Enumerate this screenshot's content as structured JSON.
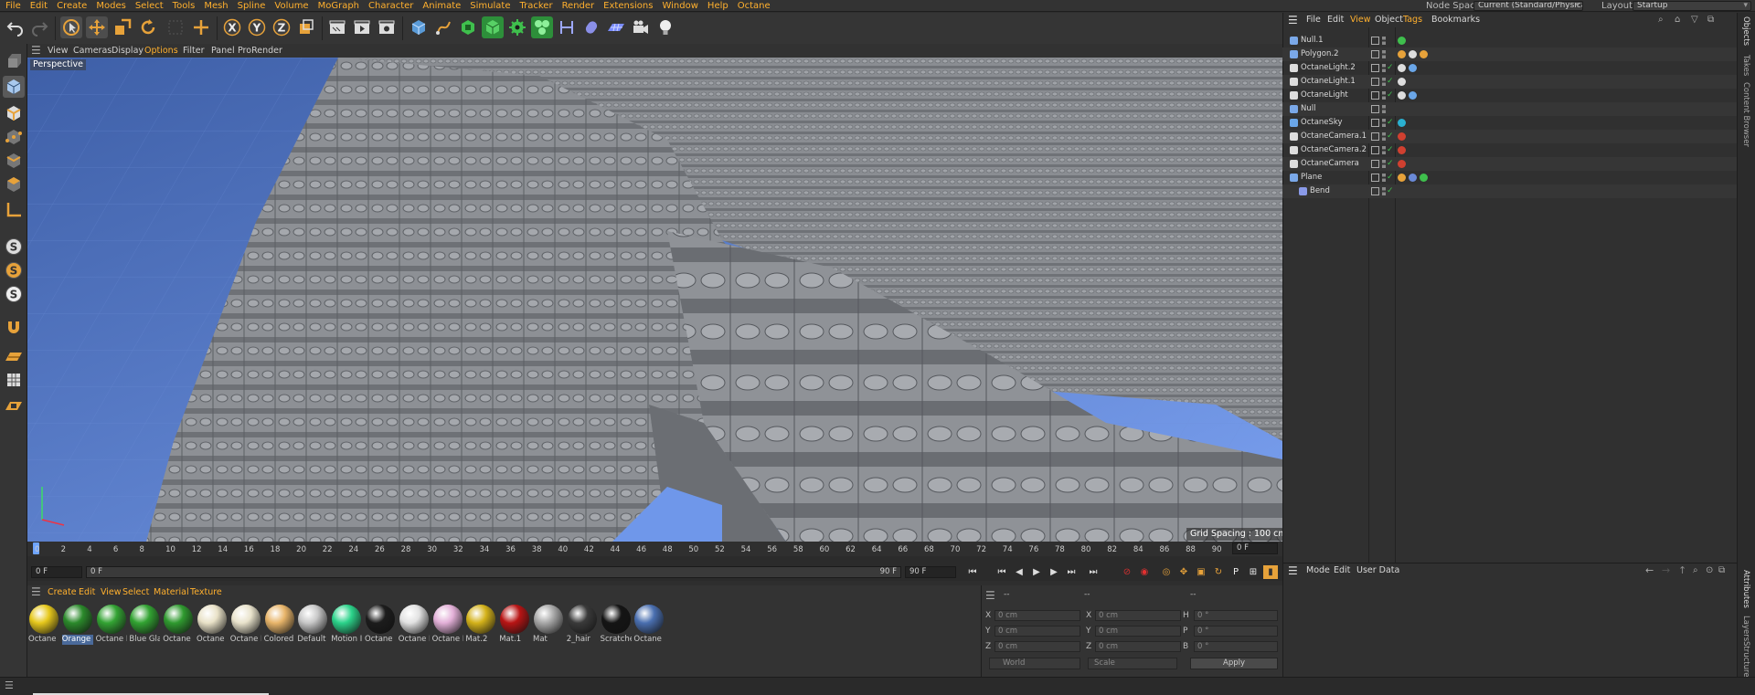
{
  "menu": [
    "File",
    "Edit",
    "Create",
    "Modes",
    "Select",
    "Tools",
    "Mesh",
    "Spline",
    "Volume",
    "MoGraph",
    "Character",
    "Animate",
    "Simulate",
    "Tracker",
    "Render",
    "Extensions",
    "Window",
    "Help",
    "Octane"
  ],
  "node_space": {
    "label": "Node Space:",
    "value": "Current (Standard/Physical)"
  },
  "layout": {
    "label": "Layout:",
    "value": "Startup"
  },
  "toolbar": {
    "x_label": "X",
    "y_label": "Y",
    "z_label": "Z"
  },
  "left_tools": {
    "s_label": "S"
  },
  "viewport": {
    "menu": [
      "View",
      "Cameras",
      "Display",
      "Options",
      "Filter",
      "Panel",
      "ProRender"
    ],
    "label": "Perspective",
    "grid_spacing": "Grid Spacing : 100 cm"
  },
  "timeline": {
    "ticks": [
      "0",
      "2",
      "4",
      "6",
      "8",
      "10",
      "12",
      "14",
      "16",
      "18",
      "20",
      "22",
      "24",
      "26",
      "28",
      "30",
      "32",
      "34",
      "36",
      "38",
      "40",
      "42",
      "44",
      "46",
      "48",
      "50",
      "52",
      "54",
      "56",
      "58",
      "60",
      "62",
      "64",
      "66",
      "68",
      "70",
      "72",
      "74",
      "76",
      "78",
      "80",
      "82",
      "84",
      "86",
      "88",
      "90"
    ],
    "current_frame": "0 F",
    "start": "0 F",
    "min": "0 F",
    "max": "90 F",
    "end": "90 F",
    "p_label": "P"
  },
  "materials": {
    "menu": [
      "Create",
      "Edit",
      "View",
      "Select",
      "Material",
      "Texture"
    ],
    "items": [
      {
        "name": "Octane I",
        "color": "#e6c81c"
      },
      {
        "name": "Orange",
        "color": "#2b8a2b"
      },
      {
        "name": "Octane I",
        "color": "#33a333"
      },
      {
        "name": "Blue Gla",
        "color": "#32a332"
      },
      {
        "name": "Octane I",
        "color": "#2f9a2f"
      },
      {
        "name": "Octane I",
        "color": "#e9e2c8"
      },
      {
        "name": "Octane I",
        "color": "#e9e3cc"
      },
      {
        "name": "Colored",
        "color": "#e8b56a"
      },
      {
        "name": "Default",
        "color": "#c8c8c8"
      },
      {
        "name": "Motion I",
        "color": "#2bd38a"
      },
      {
        "name": "Octane I",
        "color": "#1c1c1c"
      },
      {
        "name": "Octane I",
        "color": "#e2e2e2"
      },
      {
        "name": "Octane I",
        "color": "#e3b0d8"
      },
      {
        "name": "Mat.2",
        "color": "#d4b21a"
      },
      {
        "name": "Mat.1",
        "color": "#b81414"
      },
      {
        "name": "Mat",
        "color": "#a8a8a8"
      },
      {
        "name": "2_hair",
        "color": "#3a3a3a"
      },
      {
        "name": "Scratche",
        "color": "#151515"
      },
      {
        "name": "Octane I",
        "color": "#4a6fb0"
      }
    ]
  },
  "coords": {
    "col1": "--",
    "col2": "--",
    "col3": "--",
    "rows": [
      {
        "a": "X",
        "av": "0 cm",
        "b": "X",
        "bv": "0 cm",
        "c": "H",
        "cv": "0 °"
      },
      {
        "a": "Y",
        "av": "0 cm",
        "b": "Y",
        "bv": "0 cm",
        "c": "P",
        "cv": "0 °"
      },
      {
        "a": "Z",
        "av": "0 cm",
        "b": "Z",
        "bv": "0 cm",
        "c": "B",
        "cv": "0 °"
      }
    ],
    "world": "World",
    "scale": "Scale",
    "apply": "Apply"
  },
  "objects": {
    "menu": [
      "File",
      "Edit",
      "View",
      "Object",
      "Tags",
      "Bookmarks"
    ],
    "rows": [
      {
        "name": "Null.1",
        "indent": 0
      },
      {
        "name": "Polygon.2",
        "indent": 0
      },
      {
        "name": "OctaneLight.2",
        "indent": 0
      },
      {
        "name": "OctaneLight.1",
        "indent": 0
      },
      {
        "name": "OctaneLight",
        "indent": 0
      },
      {
        "name": "Null",
        "indent": 0
      },
      {
        "name": "OctaneSky",
        "indent": 0
      },
      {
        "name": "OctaneCamera.1",
        "indent": 0
      },
      {
        "name": "OctaneCamera.2",
        "indent": 0
      },
      {
        "name": "OctaneCamera",
        "indent": 0
      },
      {
        "name": "Plane",
        "indent": 0
      },
      {
        "name": "Bend",
        "indent": 1
      }
    ]
  },
  "attributes": {
    "menu": [
      "Mode",
      "Edit",
      "User Data"
    ]
  },
  "side_tabs": [
    "Objects",
    "Takes",
    "Content Browser",
    "Attributes",
    "Layers",
    "Structure"
  ]
}
